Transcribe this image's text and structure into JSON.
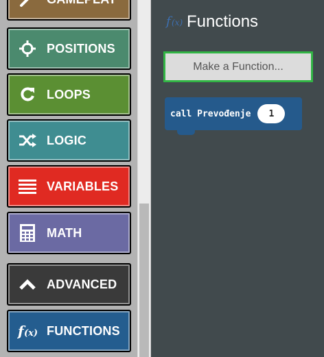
{
  "categories": [
    {
      "label": "GAMEPLAY",
      "color": "#8a6a3e",
      "icon": "wrench-icon"
    },
    {
      "label": "POSITIONS",
      "color": "#4b8a6e",
      "icon": "crosshair-icon"
    },
    {
      "label": "LOOPS",
      "color": "#5b8f33",
      "icon": "loop-arrow-icon"
    },
    {
      "label": "LOGIC",
      "color": "#3f8d91",
      "icon": "shuffle-icon"
    },
    {
      "label": "VARIABLES",
      "color": "#e02a22",
      "icon": "list-lines-icon"
    },
    {
      "label": "MATH",
      "color": "#6b6aa3",
      "icon": "calculator-icon"
    },
    {
      "label": "ADVANCED",
      "color": "#3a3a3a",
      "icon": "chevron-up-icon"
    },
    {
      "label": "FUNCTIONS",
      "color": "#245d8f",
      "icon": "function-icon"
    }
  ],
  "flyout": {
    "title": "Functions",
    "title_icon": "function-icon",
    "make_button": "Make a Function...",
    "make_button_border": "#32b545",
    "block": {
      "text": "call Prevođenje",
      "arg": "1",
      "color": "#255a8c"
    }
  }
}
